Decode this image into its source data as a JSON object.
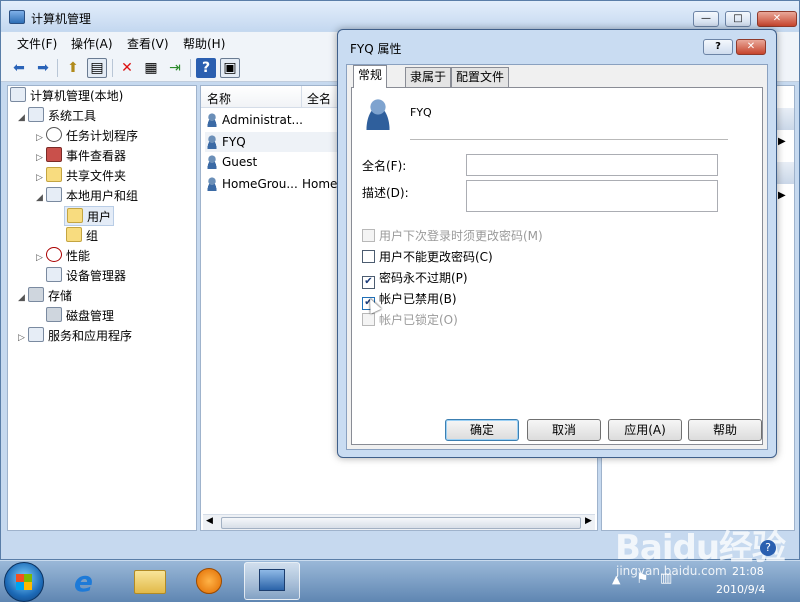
{
  "main_window": {
    "title": "计算机管理",
    "controls": {
      "minimize": "—",
      "maximize": "□",
      "close": "✕"
    },
    "menu": [
      "文件(F)",
      "操作(A)",
      "查看(V)",
      "帮助(H)"
    ],
    "toolbar_icons": [
      "back-arrow-icon",
      "forward-arrow-icon",
      "up-folder-icon",
      "show-tree-icon",
      "delete-icon",
      "properties-icon",
      "export-icon",
      "help-icon",
      "panel-icon"
    ]
  },
  "tree": {
    "root": "计算机管理(本地)",
    "system_tools": "系统工具",
    "task_scheduler": "任务计划程序",
    "event_viewer": "事件查看器",
    "shared_folders": "共享文件夹",
    "local_users_groups": "本地用户和组",
    "users": "用户",
    "groups": "组",
    "performance": "性能",
    "device_manager": "设备管理器",
    "storage": "存储",
    "disk_management": "磁盘管理",
    "services_apps": "服务和应用程序"
  },
  "list": {
    "columns": [
      "名称",
      "全名"
    ],
    "rows": [
      {
        "name": "Administrat...",
        "full": ""
      },
      {
        "name": "FYQ",
        "full": ""
      },
      {
        "name": "Guest",
        "full": ""
      },
      {
        "name": "HomeGrou...",
        "full": "Home"
      }
    ]
  },
  "dialog": {
    "title": "FYQ 属性",
    "controls": {
      "help": "?",
      "close": "✕"
    },
    "tabs": [
      "常规",
      "隶属于",
      "配置文件"
    ],
    "username": "FYQ",
    "fullname_label": "全名(F):",
    "fullname_value": "",
    "description_label": "描述(D):",
    "description_value": "",
    "checkboxes": [
      {
        "label": "用户下次登录时须更改密码(M)",
        "checked": false,
        "disabled": true
      },
      {
        "label": "用户不能更改密码(C)",
        "checked": false,
        "disabled": false
      },
      {
        "label": "密码永不过期(P)",
        "checked": true,
        "disabled": false
      },
      {
        "label": "帐户已禁用(B)",
        "checked": true,
        "disabled": false
      },
      {
        "label": "帐户已锁定(O)",
        "checked": false,
        "disabled": true
      }
    ],
    "buttons": {
      "ok": "确定",
      "cancel": "取消",
      "apply": "应用(A)",
      "help": "帮助"
    }
  },
  "taskbar": {
    "time": "21:08",
    "date": "2010/9/4",
    "watermark": "Baidu经验",
    "watermark_url": "jingyan.baidu.com"
  }
}
